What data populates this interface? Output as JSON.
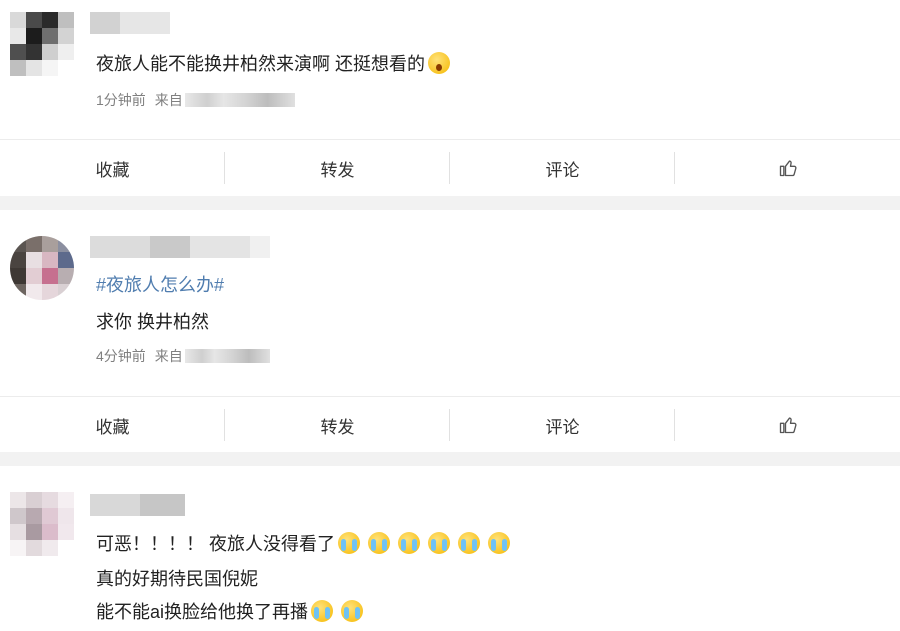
{
  "posts": [
    {
      "lines": [
        {
          "text": "夜旅人能不能换井柏然来演啊 还挺想看的"
        }
      ],
      "emoji": [
        "shock"
      ],
      "time": "1分钟前",
      "from": "来自"
    },
    {
      "hashtag": "#夜旅人怎么办#",
      "lines": [
        {
          "text": "求你 换井柏然"
        }
      ],
      "time": "4分钟前",
      "from": "来自"
    },
    {
      "lines": [
        {
          "text": "可恶！！！！ 夜旅人没得看了"
        },
        {
          "text": "真的好期待民国倪妮"
        },
        {
          "text": "能不能ai换脸给他换了再播"
        }
      ]
    }
  ],
  "actions": {
    "favorite": "收藏",
    "repost": "转发",
    "comment": "评论",
    "like_icon": "thumbs-up-icon"
  },
  "colors": {
    "hashtag": "#507daf",
    "meta": "#808080",
    "separator": "#f2f2f2"
  }
}
